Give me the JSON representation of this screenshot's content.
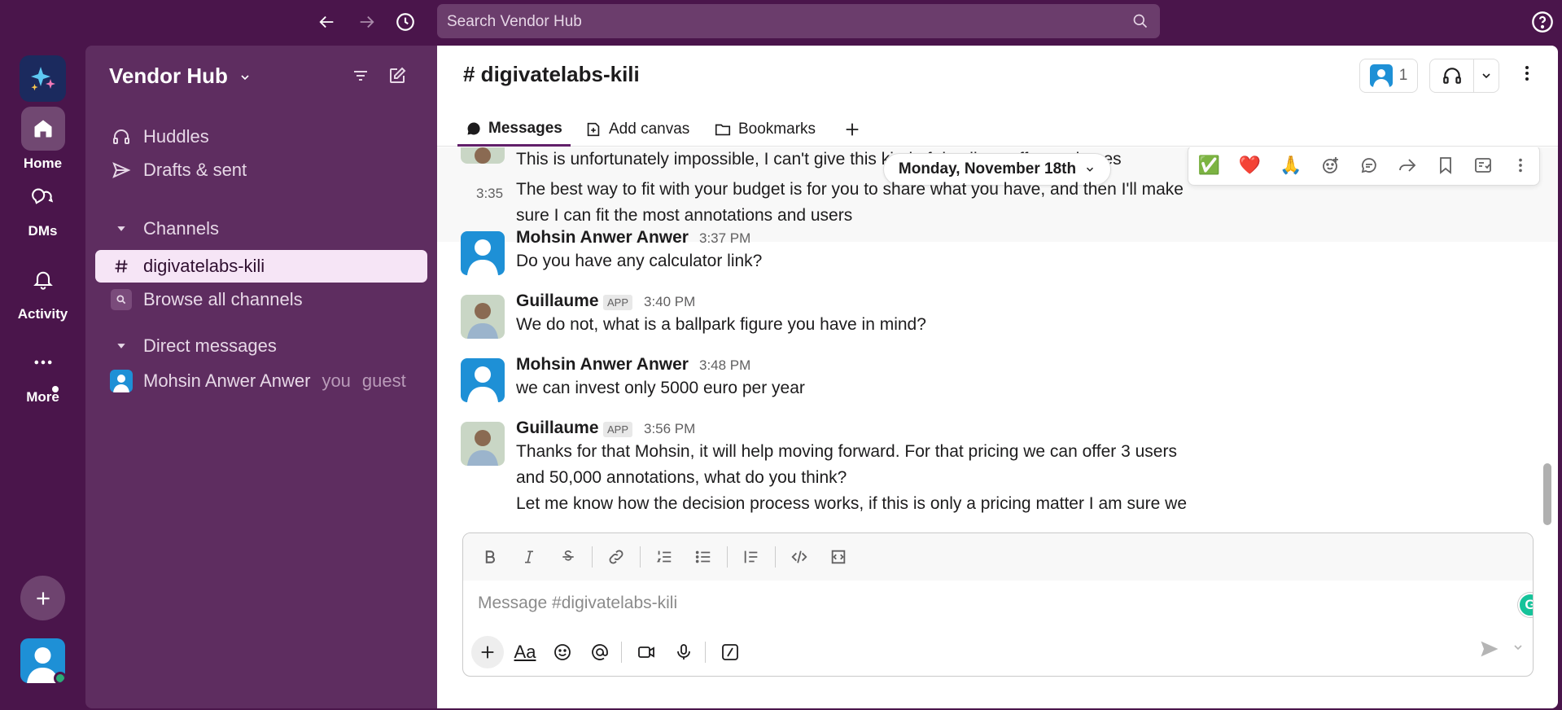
{
  "topbar": {
    "search_placeholder": "Search Vendor Hub"
  },
  "rail": {
    "items": [
      {
        "label": "Home"
      },
      {
        "label": "DMs"
      },
      {
        "label": "Activity"
      },
      {
        "label": "More"
      }
    ]
  },
  "sidebar": {
    "workspace": "Vendor Hub",
    "items": [
      {
        "label": "Huddles"
      },
      {
        "label": "Drafts & sent"
      }
    ],
    "channels_header": "Channels",
    "channels": [
      {
        "label": "digivatelabs-kili"
      },
      {
        "label": "Browse all channels"
      }
    ],
    "dm_header": "Direct messages",
    "dms": [
      {
        "label": "Mohsin Anwer Anwer",
        "you": "you",
        "guest": "guest"
      }
    ]
  },
  "channel": {
    "title": "# digivatelabs-kili",
    "member_count": "1",
    "tabs": [
      {
        "label": "Messages"
      },
      {
        "label": "Add canvas"
      },
      {
        "label": "Bookmarks"
      }
    ]
  },
  "date_divider": "Monday, November 18th",
  "reactions": [
    "✅",
    "❤️",
    "🙏"
  ],
  "messages": [
    {
      "text": "This is unfortunately impossible, I can't give this kind of details ... offer packages"
    },
    {
      "time": "3:35",
      "text": "The best way to fit with your budget is for you to share what you have, and then I'll make",
      "text2": "sure I can fit the most annotations and users"
    },
    {
      "name": "Mohsin Anwer Anwer",
      "time": "3:37 PM",
      "text": "Do you have any calculator link?"
    },
    {
      "name": "Guillaume",
      "badge": "APP",
      "time": "3:40 PM",
      "text": "We do not, what is a ballpark figure you have in mind?"
    },
    {
      "name": "Mohsin Anwer Anwer",
      "time": "3:48 PM",
      "text": "we can invest only 5000 euro per year"
    },
    {
      "name": "Guillaume",
      "badge": "APP",
      "time": "3:56 PM",
      "text": "Thanks for that Mohsin, it will help moving forward. For that pricing we can offer 3 users",
      "text2": "and 50,000 annotations, what do you think?",
      "text3": "Let me know how the decision process works, if this is only a pricing matter I am sure we"
    }
  ],
  "composer": {
    "placeholder": "Message #digivatelabs-kili",
    "grammarly": "G",
    "aa_label": "Aa"
  }
}
